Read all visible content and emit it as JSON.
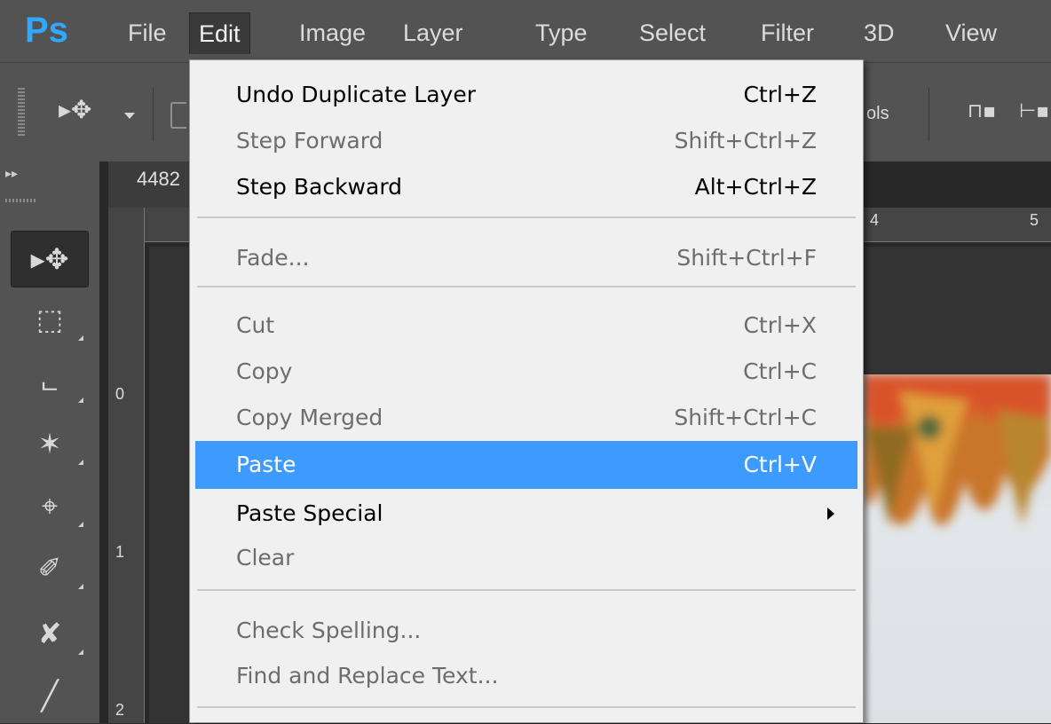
{
  "app": {
    "logo": "Ps",
    "logo_color": "#31a8ff"
  },
  "menubar": {
    "items": [
      "File",
      "Edit",
      "Image",
      "Layer",
      "Type",
      "Select",
      "Filter",
      "3D",
      "View"
    ],
    "active": "Edit"
  },
  "options_bar": {
    "partial_text": "ols"
  },
  "document": {
    "tab_label": "4482",
    "ruler_h_labels": [
      "4",
      "5"
    ],
    "ruler_v_labels": [
      "0",
      "1",
      "2"
    ]
  },
  "tools": [
    {
      "name": "move-tool",
      "glyph": "▸✥",
      "selected": true
    },
    {
      "name": "marquee-tool",
      "glyph": "⬚",
      "selected": false
    },
    {
      "name": "lasso-tool",
      "glyph": "⨽",
      "selected": false
    },
    {
      "name": "magic-wand-tool",
      "glyph": "✶",
      "selected": false
    },
    {
      "name": "crop-tool",
      "glyph": "⌖",
      "selected": false
    },
    {
      "name": "eyedropper-tool",
      "glyph": "✐",
      "selected": false
    },
    {
      "name": "healing-brush-tool",
      "glyph": "✘",
      "selected": false
    },
    {
      "name": "brush-tool",
      "glyph": "╱",
      "selected": false
    }
  ],
  "edit_menu": {
    "items": [
      {
        "label": "Undo Duplicate Layer",
        "shortcut": "Ctrl+Z",
        "enabled": true
      },
      {
        "label": "Step Forward",
        "shortcut": "Shift+Ctrl+Z",
        "enabled": false
      },
      {
        "label": "Step Backward",
        "shortcut": "Alt+Ctrl+Z",
        "enabled": true
      },
      {
        "label": "Fade...",
        "shortcut": "Shift+Ctrl+F",
        "enabled": false
      },
      {
        "label": "Cut",
        "shortcut": "Ctrl+X",
        "enabled": false
      },
      {
        "label": "Copy",
        "shortcut": "Ctrl+C",
        "enabled": false
      },
      {
        "label": "Copy Merged",
        "shortcut": "Shift+Ctrl+C",
        "enabled": false
      },
      {
        "label": "Paste",
        "shortcut": "Ctrl+V",
        "enabled": true,
        "highlighted": true
      },
      {
        "label": "Paste Special",
        "shortcut": "",
        "enabled": true,
        "submenu": true
      },
      {
        "label": "Clear",
        "shortcut": "",
        "enabled": false
      },
      {
        "label": "Check Spelling...",
        "shortcut": "",
        "enabled": false
      },
      {
        "label": "Find and Replace Text...",
        "shortcut": "",
        "enabled": false
      }
    ],
    "highlight_color": "#3d9bff"
  }
}
